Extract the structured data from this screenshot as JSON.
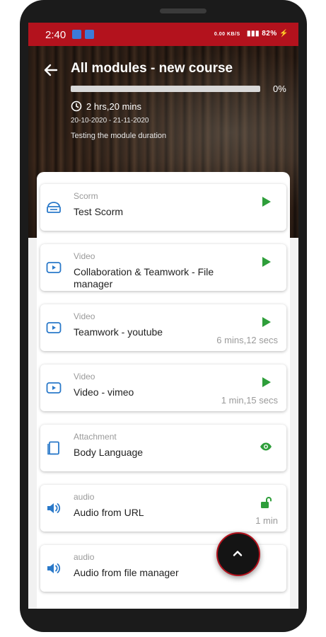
{
  "status": {
    "time": "2:40",
    "battery": "82%",
    "signal_text": "0.00 KB/S"
  },
  "header": {
    "title": "All modules - new course",
    "progress_value": 0,
    "progress_text": "0%",
    "duration": "2 hrs,20 mins",
    "dates": "20-10-2020 - 21-11-2020",
    "description": "Testing the module duration"
  },
  "modules": [
    {
      "type": "Scorm",
      "name": "Test Scorm",
      "icon": "scorm-icon",
      "action": "play-icon",
      "duration": ""
    },
    {
      "type": "Video",
      "name": "Collaboration & Teamwork - File manager",
      "icon": "video-icon",
      "action": "play-icon",
      "duration": ""
    },
    {
      "type": "Video",
      "name": "Teamwork - youtube",
      "icon": "video-icon",
      "action": "play-icon",
      "duration": "6 mins,12 secs"
    },
    {
      "type": "Video",
      "name": "Video - vimeo",
      "icon": "video-icon",
      "action": "play-icon",
      "duration": "1 min,15 secs"
    },
    {
      "type": "Attachment",
      "name": "Body Language",
      "icon": "document-icon",
      "action": "eye-icon",
      "duration": ""
    },
    {
      "type": "audio",
      "name": "Audio from URL",
      "icon": "speaker-icon",
      "action": "unlock-icon",
      "duration": "1 min"
    },
    {
      "type": "audio",
      "name": "Audio from file manager",
      "icon": "speaker-icon",
      "action": "",
      "duration": ""
    }
  ],
  "colors": {
    "accent": "#b3121d",
    "action_green": "#2e9e3a",
    "icon_blue": "#2a79c9"
  }
}
